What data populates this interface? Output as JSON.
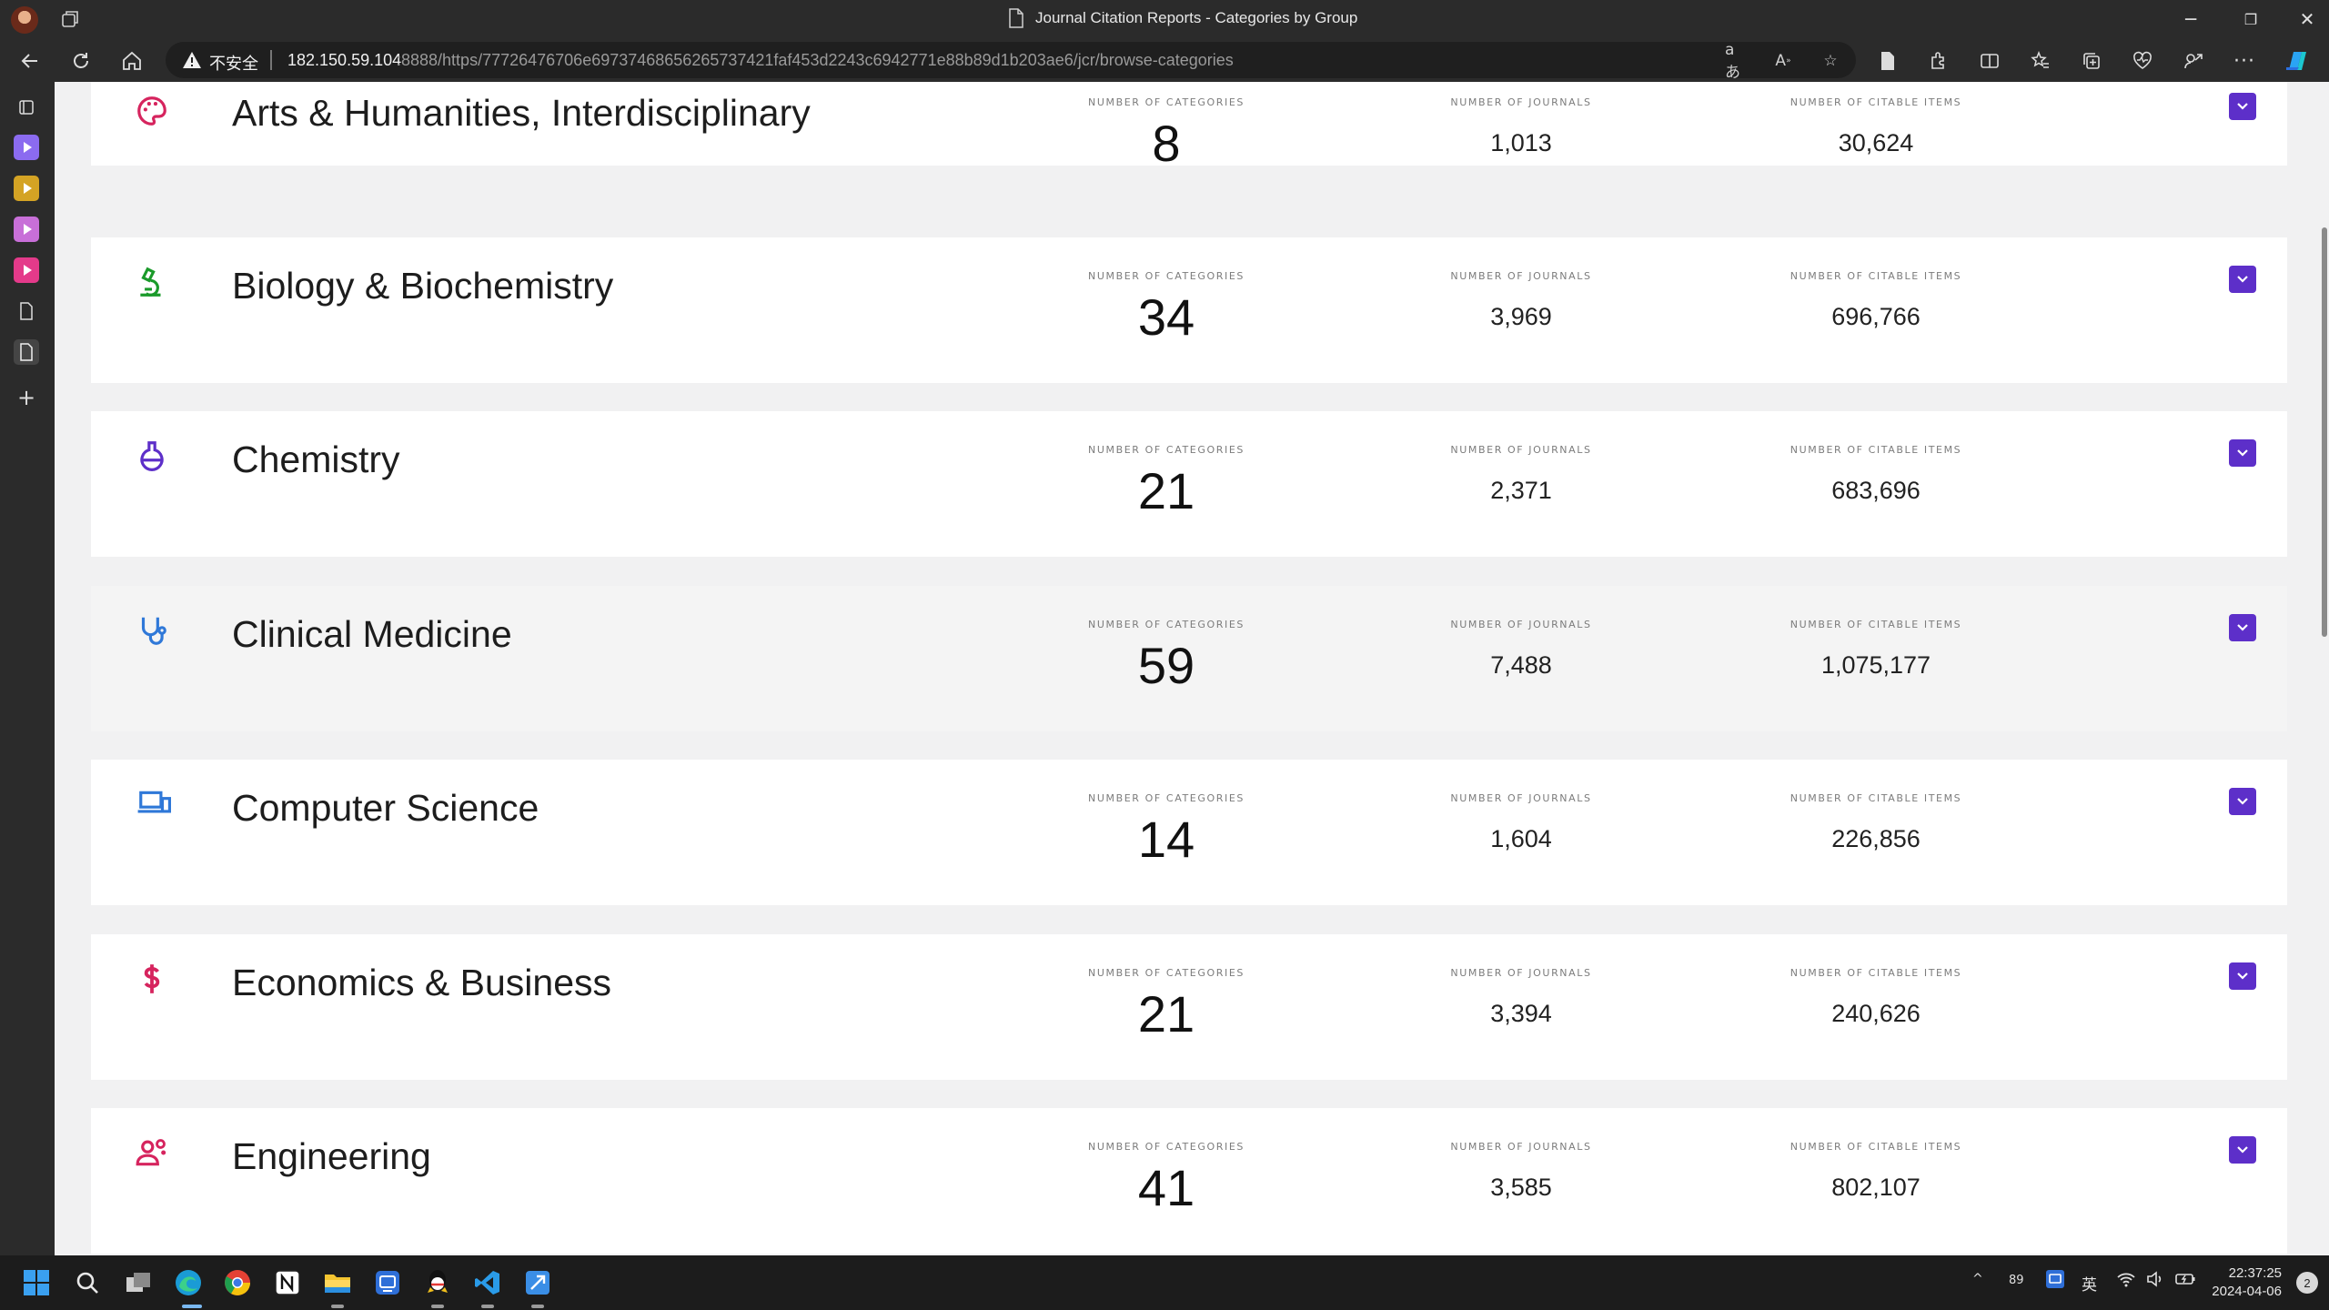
{
  "window": {
    "title": "Journal Citation Reports - Categories by Group",
    "controls": [
      "minimize",
      "restore",
      "close"
    ]
  },
  "addressbar": {
    "security_label": "不安全",
    "url_host": "182.150.59.104",
    "url_rest": ":8888/https/77726476706e69737468656265737421faf453d2243c6942771e88b89d1b203ae6/jcr/browse-categories",
    "icons": [
      "read-aloud-icon",
      "text-size-icon",
      "favorite-star-icon"
    ]
  },
  "toolbar_icons": [
    "page-icon",
    "extensions-icon",
    "split-screen-icon",
    "favorites-icon",
    "collections-icon",
    "performance-icon",
    "share-icon",
    "more-icon",
    "copilot-icon"
  ],
  "sidebar_items": [
    "tab-actions-icon",
    "tab-video-1",
    "tab-video-2",
    "tab-video-3",
    "tab-video-4",
    "tab-doc-1",
    "tab-doc-2",
    "add-tab-icon"
  ],
  "stat_labels": {
    "categories": "NUMBER OF CATEGORIES",
    "journals": "NUMBER OF JOURNALS",
    "citable": "NUMBER OF CITABLE ITEMS"
  },
  "groups": [
    {
      "name": "Arts & Humanities, Interdisciplinary",
      "icon": "palette-icon",
      "color": "#d6245e",
      "categories": "8",
      "journals": "1,013",
      "citable": "30,624"
    },
    {
      "name": "Biology & Biochemistry",
      "icon": "microscope-icon",
      "color": "#1a9a2a",
      "categories": "34",
      "journals": "3,969",
      "citable": "696,766"
    },
    {
      "name": "Chemistry",
      "icon": "flask-icon",
      "color": "#5d2fc9",
      "categories": "21",
      "journals": "2,371",
      "citable": "683,696"
    },
    {
      "name": "Clinical Medicine",
      "icon": "stethoscope-icon",
      "color": "#2f78d8",
      "categories": "59",
      "journals": "7,488",
      "citable": "1,075,177"
    },
    {
      "name": "Computer Science",
      "icon": "devices-icon",
      "color": "#2f78d8",
      "categories": "14",
      "journals": "1,604",
      "citable": "226,856"
    },
    {
      "name": "Economics & Business",
      "icon": "dollar-icon",
      "color": "#d6245e",
      "categories": "21",
      "journals": "3,394",
      "citable": "240,626"
    },
    {
      "name": "Engineering",
      "icon": "engineer-icon",
      "color": "#d6245e",
      "categories": "41",
      "journals": "3,585",
      "citable": "802,107"
    }
  ],
  "taskbar": {
    "apps": [
      "windows-start-icon",
      "search-icon",
      "task-view-icon",
      "edge-icon",
      "chrome-icon",
      "notion-icon",
      "file-explorer-icon",
      "app-icon",
      "qq-icon",
      "vscode-icon",
      "app2-icon"
    ],
    "tray_number": "89",
    "ime": "英",
    "time": "22:37:25",
    "date": "2024-04-06",
    "notifications": "2"
  }
}
